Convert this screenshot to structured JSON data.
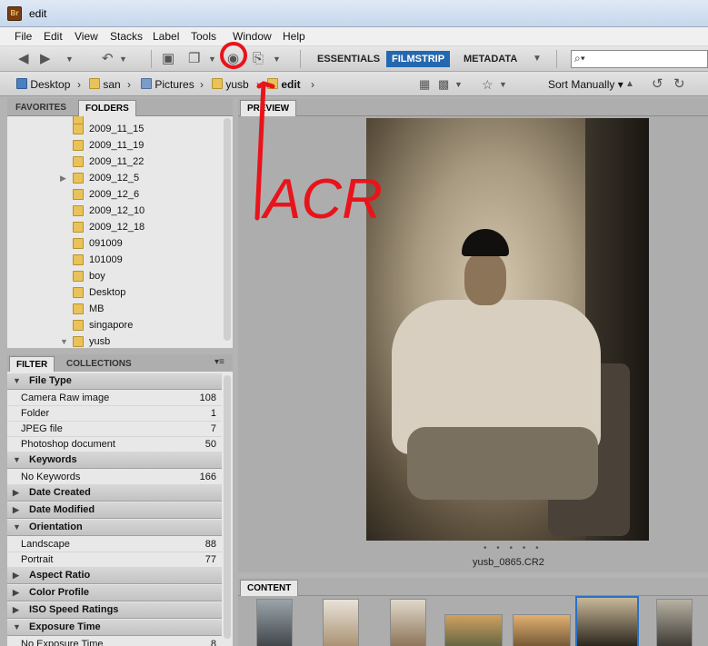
{
  "window": {
    "title": "edit",
    "app_badge": "Br"
  },
  "menu": [
    "File",
    "Edit",
    "View",
    "Stacks",
    "Label",
    "Tools",
    "Window",
    "Help"
  ],
  "workspaces": [
    {
      "label": "ESSENTIALS",
      "active": false
    },
    {
      "label": "FILMSTRIP",
      "active": true
    },
    {
      "label": "METADATA",
      "active": false
    }
  ],
  "search": {
    "icon": "magnifier-icon",
    "value": ""
  },
  "path": [
    "Desktop",
    "san",
    "Pictures",
    "yusb",
    "edit"
  ],
  "sort": {
    "label": "Sort Manually"
  },
  "left_tabs": {
    "favorites": "FAVORITES",
    "folders": "FOLDERS"
  },
  "folders": [
    {
      "name": "2009_11_15"
    },
    {
      "name": "2009_11_19"
    },
    {
      "name": "2009_11_22"
    },
    {
      "name": "2009_12_5"
    },
    {
      "name": "2009_12_6"
    },
    {
      "name": "2009_12_10"
    },
    {
      "name": "2009_12_18"
    },
    {
      "name": "091009"
    },
    {
      "name": "101009"
    },
    {
      "name": "boy"
    },
    {
      "name": "Desktop"
    },
    {
      "name": "MB"
    },
    {
      "name": "singapore"
    },
    {
      "name": "yusb"
    }
  ],
  "filter_tabs": {
    "filter": "FILTER",
    "collections": "COLLECTIONS"
  },
  "filter": {
    "file_type": {
      "title": "File Type",
      "items": [
        {
          "label": "Camera Raw image",
          "count": "108"
        },
        {
          "label": "Folder",
          "count": "1"
        },
        {
          "label": "JPEG file",
          "count": "7"
        },
        {
          "label": "Photoshop document",
          "count": "50"
        }
      ]
    },
    "keywords": {
      "title": "Keywords",
      "items": [
        {
          "label": "No Keywords",
          "count": "166"
        }
      ]
    },
    "date_created": {
      "title": "Date Created"
    },
    "date_modified": {
      "title": "Date Modified"
    },
    "orientation": {
      "title": "Orientation",
      "items": [
        {
          "label": "Landscape",
          "count": "88"
        },
        {
          "label": "Portrait",
          "count": "77"
        }
      ]
    },
    "aspect_ratio": {
      "title": "Aspect Ratio"
    },
    "color_profile": {
      "title": "Color Profile"
    },
    "iso": {
      "title": "ISO Speed Ratings"
    },
    "exposure_time": {
      "title": "Exposure Time",
      "items": [
        {
          "label": "No Exposure Time",
          "count": "8"
        }
      ]
    }
  },
  "preview": {
    "tab": "PREVIEW",
    "filename": "yusb_0865.CR2",
    "dots": "• • • • •"
  },
  "content": {
    "tab": "CONTENT"
  },
  "annotation": {
    "text": "ACR",
    "color": "#e8141b"
  },
  "colors": {
    "accent": "#2468b0",
    "annotation": "#e8141b"
  }
}
